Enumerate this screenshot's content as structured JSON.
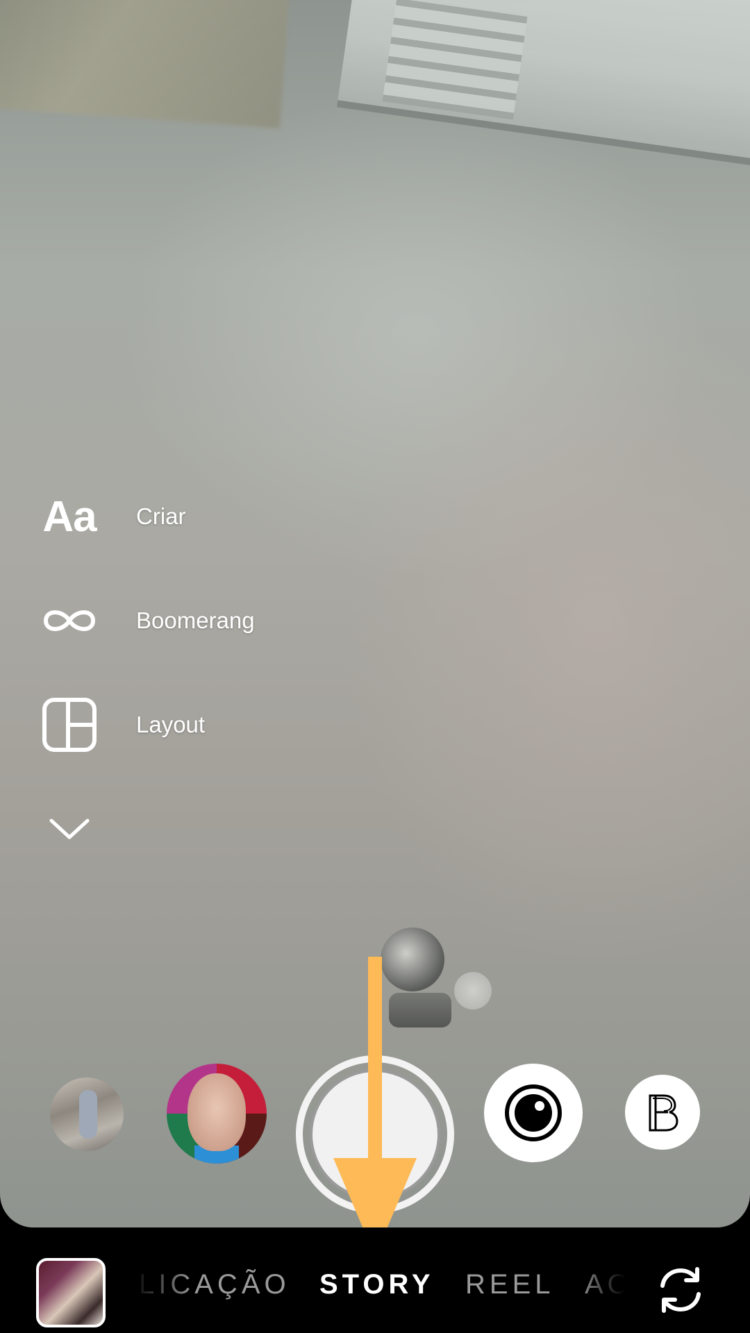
{
  "side_menu": {
    "items": [
      {
        "icon": "text-create-icon",
        "icon_text": "Aa",
        "label": "Criar"
      },
      {
        "icon": "infinity-icon",
        "label": "Boomerang"
      },
      {
        "icon": "layout-grid-icon",
        "label": "Layout"
      },
      {
        "icon": "chevron-down-icon"
      }
    ]
  },
  "capture": {
    "effects": [
      "gallery-photo",
      "face-filter",
      "shutter",
      "camera-effect-icon",
      "b-effect-icon"
    ]
  },
  "modes": {
    "items": [
      "LICAÇÃO",
      "STORY",
      "REEL",
      "AO"
    ],
    "active": "STORY"
  },
  "colors": {
    "annotation_arrow": "#FDBA56",
    "active_mode": "#FFFFFF",
    "inactive_mode": "#9A9A9A"
  }
}
